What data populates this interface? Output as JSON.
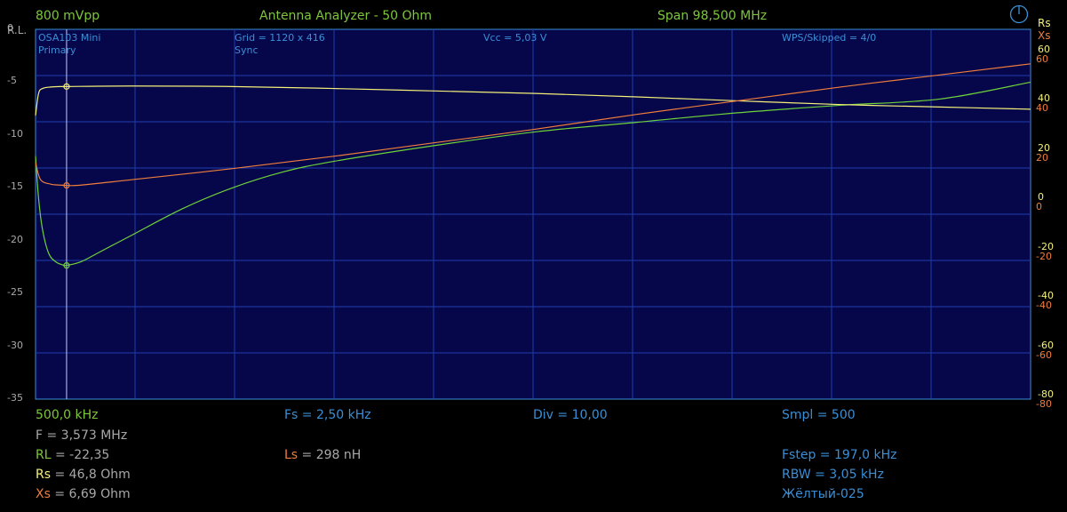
{
  "header": {
    "amplitude": "800 mVpp",
    "mode": "Antenna Analyzer - 50 Ohm",
    "span": "Span 98,500 MHz"
  },
  "axes_labels": {
    "left": "R.L.",
    "right_rs": "Rs",
    "right_xs": "Xs"
  },
  "plot_info": {
    "device": "OSA103 Mini",
    "channel": "Primary",
    "grid": "Grid = 1120 x 416",
    "sync": "Sync",
    "vcc": "Vcc = 5,03 V",
    "wps": "WPS/Skipped  = 4/0"
  },
  "footer": {
    "start_freq": "500,0 kHz",
    "fs": "Fs = 2,50 kHz",
    "div": "Div = 10,00",
    "smpl": "Smpl = 500",
    "freq": "F = 3,573 MHz",
    "rl_label": "RL",
    "rl_value": " = -22,35",
    "ls_label": "Ls",
    "ls_value": " = 298 nH",
    "fstep": "Fstep = 197,0 kHz",
    "rs_label": "Rs",
    "rs_value": " = 46,8 Ohm",
    "rbw": "RBW = 3,05 kHz",
    "xs_label": "Xs",
    "xs_value": " = 6,69 Ohm",
    "preset": "Жёлтый-025"
  },
  "colors": {
    "rl": "#6fd23a",
    "rs": "#f4f07a",
    "xs": "#ef7d3c",
    "axis": "#3a8fd6",
    "grid": "#1f3cb0",
    "plot_bg": "#05074a",
    "cursor": "#c8c8ff"
  },
  "chart_data": {
    "type": "line",
    "x_unit": "MHz",
    "xlim": [
      0.5,
      99.0
    ],
    "cursor_x": 3.573,
    "y_left": {
      "label": "R.L.",
      "ylim": [
        -35,
        0
      ],
      "ticks": [
        0,
        -5,
        -10,
        -15,
        -20,
        -25,
        -30,
        -35
      ]
    },
    "y_right_rs": {
      "label": "Rs",
      "ticks": [
        60,
        40,
        20,
        0,
        -20,
        -40,
        -60,
        -80
      ]
    },
    "y_right_xs": {
      "label": "Xs",
      "ticks": [
        60,
        40,
        20,
        0,
        -20,
        -40,
        -60,
        -80
      ]
    },
    "y_right_lim": [
      -80,
      70
    ],
    "series": [
      {
        "name": "RL",
        "axis": "left",
        "x": [
          0.5,
          0.8,
          1.2,
          1.8,
          2.5,
          3.2,
          3.573,
          5,
          7,
          10,
          15,
          20,
          25,
          30,
          40,
          50,
          60,
          70,
          80,
          90,
          99
        ],
        "y": [
          -12.0,
          -16.0,
          -19.0,
          -21.2,
          -22.0,
          -22.3,
          -22.35,
          -22.0,
          -21.0,
          -19.5,
          -17.0,
          -15.0,
          -13.5,
          -12.5,
          -11.0,
          -9.7,
          -8.8,
          -7.9,
          -7.2,
          -6.6,
          -5.0
        ]
      },
      {
        "name": "Rs",
        "axis": "right",
        "x": [
          0.5,
          0.8,
          1.2,
          2.0,
          3.0,
          3.573,
          10,
          20,
          30,
          40,
          50,
          60,
          70,
          80,
          90,
          99
        ],
        "y": [
          35.0,
          44.0,
          46.0,
          46.6,
          46.8,
          46.8,
          47.0,
          46.8,
          46.0,
          45.0,
          44.0,
          42.6,
          41.0,
          39.5,
          38.5,
          37.6
        ]
      },
      {
        "name": "Xs",
        "axis": "right",
        "x": [
          0.5,
          1.0,
          2.0,
          3.0,
          3.573,
          5,
          10,
          20,
          30,
          40,
          50,
          60,
          70,
          80,
          90,
          99
        ],
        "y": [
          16.0,
          9.0,
          7.2,
          6.8,
          6.69,
          6.8,
          9.0,
          13.5,
          18.5,
          24.0,
          29.5,
          35.5,
          41.0,
          46.5,
          51.5,
          56.0
        ]
      }
    ]
  }
}
